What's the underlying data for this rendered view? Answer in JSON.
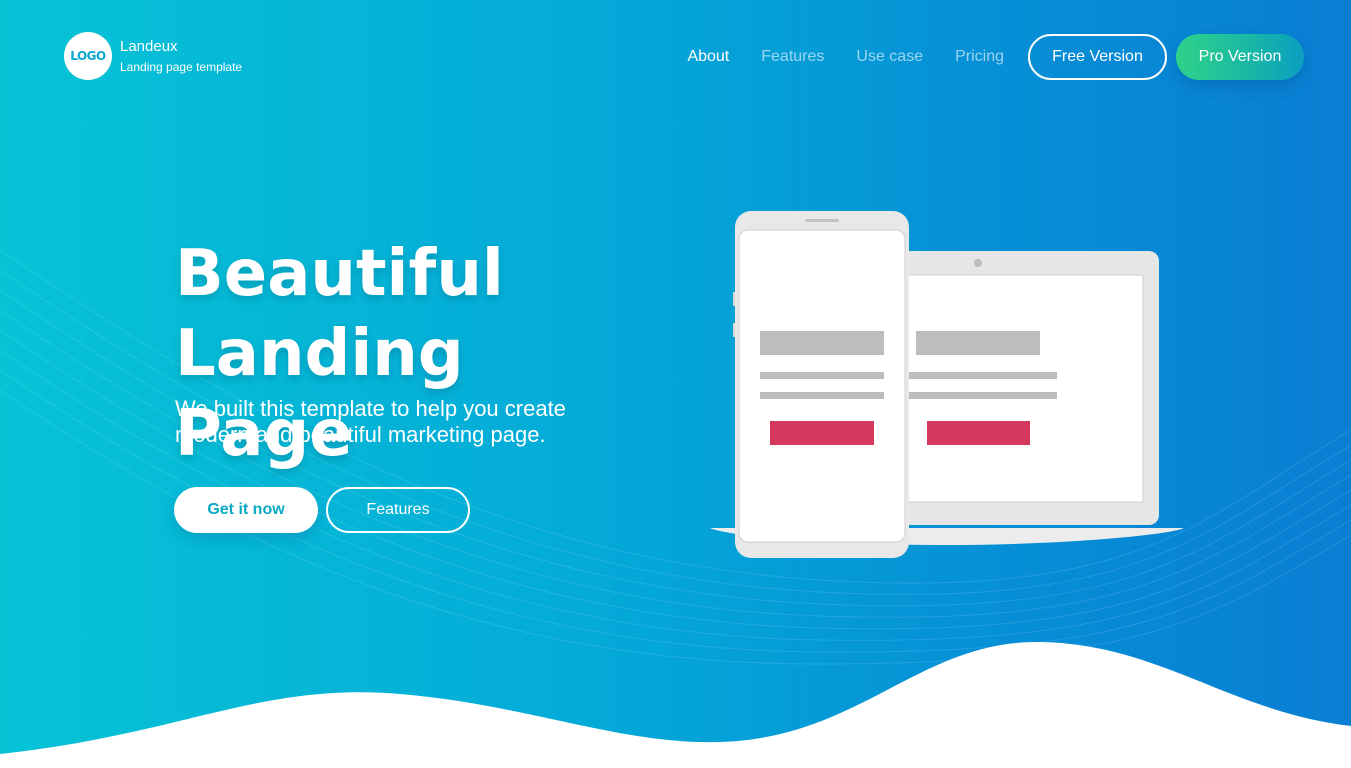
{
  "header": {
    "logo_text": "LOGO",
    "brand_name": "Landeux",
    "brand_tagline": "Landing page template",
    "nav": [
      {
        "label": "About"
      },
      {
        "label": "Features"
      },
      {
        "label": "Use case"
      },
      {
        "label": "Pricing"
      }
    ],
    "free_button": "Free Version",
    "pro_button": "Pro Version"
  },
  "hero": {
    "title_line1": "Beautiful",
    "title_line2": "Landing Page",
    "subtitle_line1": "We built this template to help you create",
    "subtitle_line2": "modern and beautiful marketing page.",
    "primary_button": "Get it now",
    "secondary_button": "Features"
  },
  "colors": {
    "gradient_start": "#06c3d6",
    "gradient_end": "#0a7ed3",
    "pro_button_start": "#2fd28a",
    "cta_red": "#d6375c",
    "placeholder_gray": "#bdbdbd"
  }
}
